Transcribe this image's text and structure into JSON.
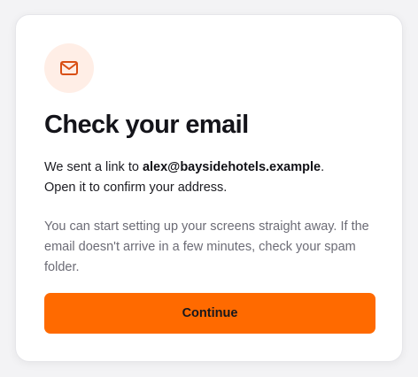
{
  "icon": {
    "name": "mail-icon",
    "color": "#d94f14",
    "bg_color": "#ffeee6"
  },
  "title": "Check your email",
  "message": {
    "prefix": "We sent a link to ",
    "email": "alex@baysidehotels.example",
    "suffix": ".",
    "line2": "Open it to confirm your address."
  },
  "help_text": "You can start setting up your screens straight away. If the email doesn't arrive in a few minutes, check your spam folder.",
  "continue_button": {
    "label": "Continue",
    "color": "#ff6a00"
  }
}
